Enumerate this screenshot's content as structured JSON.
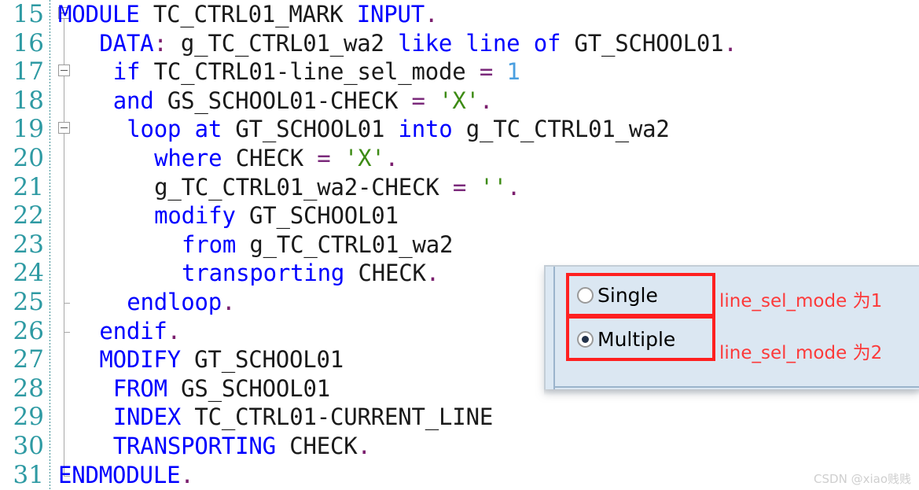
{
  "editor": {
    "first_line_number": 15,
    "colors": {
      "keyword": "#0000ff",
      "identifier": "#1a1a1a",
      "string": "#3d8b14",
      "number": "#4a9fe0",
      "operator": "#7b2a7b",
      "punctuation": "#7b1f6e",
      "line_number": "#2e9aa3",
      "background": "#ffffff"
    },
    "lines": [
      {
        "number": "15",
        "fold": "box",
        "indent": 0,
        "tokens": [
          {
            "t": "MODULE",
            "c": "kw"
          },
          {
            "t": " ",
            "c": "id"
          },
          {
            "t": "TC_CTRL01_MARK",
            "c": "id"
          },
          {
            "t": " ",
            "c": "id"
          },
          {
            "t": "INPUT",
            "c": "kw"
          },
          {
            "t": ".",
            "c": "pun"
          }
        ]
      },
      {
        "number": "16",
        "fold": "line",
        "indent": 3,
        "tokens": [
          {
            "t": "DATA",
            "c": "kw"
          },
          {
            "t": ":",
            "c": "pun"
          },
          {
            "t": " ",
            "c": "id"
          },
          {
            "t": "g_TC_CTRL01_wa2",
            "c": "id"
          },
          {
            "t": " ",
            "c": "id"
          },
          {
            "t": "like",
            "c": "kw"
          },
          {
            "t": " ",
            "c": "id"
          },
          {
            "t": "line",
            "c": "kw"
          },
          {
            "t": " ",
            "c": "id"
          },
          {
            "t": "of",
            "c": "kw"
          },
          {
            "t": " ",
            "c": "id"
          },
          {
            "t": "GT_SCHOOL01",
            "c": "id"
          },
          {
            "t": ".",
            "c": "pun"
          }
        ]
      },
      {
        "number": "17",
        "fold": "box",
        "indent": 4,
        "tokens": [
          {
            "t": "if",
            "c": "kw"
          },
          {
            "t": " ",
            "c": "id"
          },
          {
            "t": "TC_CTRL01-line_sel_mode",
            "c": "id"
          },
          {
            "t": " ",
            "c": "id"
          },
          {
            "t": "=",
            "c": "op"
          },
          {
            "t": " ",
            "c": "id"
          },
          {
            "t": "1",
            "c": "num"
          }
        ]
      },
      {
        "number": "18",
        "fold": "line",
        "indent": 4,
        "tokens": [
          {
            "t": "and",
            "c": "kw"
          },
          {
            "t": " ",
            "c": "id"
          },
          {
            "t": "GS_SCHOOL01-CHECK",
            "c": "id"
          },
          {
            "t": " ",
            "c": "id"
          },
          {
            "t": "=",
            "c": "op"
          },
          {
            "t": " ",
            "c": "id"
          },
          {
            "t": "'X'",
            "c": "str"
          },
          {
            "t": ".",
            "c": "pun"
          }
        ]
      },
      {
        "number": "19",
        "fold": "box",
        "indent": 5,
        "tokens": [
          {
            "t": "loop",
            "c": "kw"
          },
          {
            "t": " ",
            "c": "id"
          },
          {
            "t": "at",
            "c": "kw"
          },
          {
            "t": " ",
            "c": "id"
          },
          {
            "t": "GT_SCHOOL01",
            "c": "id"
          },
          {
            "t": " ",
            "c": "id"
          },
          {
            "t": "into",
            "c": "kw"
          },
          {
            "t": " ",
            "c": "id"
          },
          {
            "t": "g_TC_CTRL01_wa2",
            "c": "id"
          }
        ]
      },
      {
        "number": "20",
        "fold": "line",
        "indent": 7,
        "tokens": [
          {
            "t": "where",
            "c": "kw"
          },
          {
            "t": " ",
            "c": "id"
          },
          {
            "t": "CHECK",
            "c": "id"
          },
          {
            "t": " ",
            "c": "id"
          },
          {
            "t": "=",
            "c": "op"
          },
          {
            "t": " ",
            "c": "id"
          },
          {
            "t": "'X'",
            "c": "str"
          },
          {
            "t": ".",
            "c": "pun"
          }
        ]
      },
      {
        "number": "21",
        "fold": "line",
        "indent": 7,
        "tokens": [
          {
            "t": "g_TC_CTRL01_wa2-CHECK",
            "c": "id"
          },
          {
            "t": " ",
            "c": "id"
          },
          {
            "t": "=",
            "c": "op"
          },
          {
            "t": " ",
            "c": "id"
          },
          {
            "t": "''",
            "c": "str"
          },
          {
            "t": ".",
            "c": "pun"
          }
        ]
      },
      {
        "number": "22",
        "fold": "line",
        "indent": 7,
        "tokens": [
          {
            "t": "modify",
            "c": "kw"
          },
          {
            "t": " ",
            "c": "id"
          },
          {
            "t": "GT_SCHOOL01",
            "c": "id"
          }
        ]
      },
      {
        "number": "23",
        "fold": "line",
        "indent": 9,
        "tokens": [
          {
            "t": "from",
            "c": "kw"
          },
          {
            "t": " ",
            "c": "id"
          },
          {
            "t": "g_TC_CTRL01_wa2",
            "c": "id"
          }
        ]
      },
      {
        "number": "24",
        "fold": "line",
        "indent": 9,
        "tokens": [
          {
            "t": "transporting",
            "c": "kw"
          },
          {
            "t": " ",
            "c": "id"
          },
          {
            "t": "CHECK",
            "c": "id"
          },
          {
            "t": ".",
            "c": "pun"
          }
        ]
      },
      {
        "number": "25",
        "fold": "end",
        "indent": 5,
        "tokens": [
          {
            "t": "endloop",
            "c": "kw"
          },
          {
            "t": ".",
            "c": "pun"
          }
        ]
      },
      {
        "number": "26",
        "fold": "end",
        "indent": 3,
        "tokens": [
          {
            "t": "endif",
            "c": "kw"
          },
          {
            "t": ".",
            "c": "pun"
          }
        ]
      },
      {
        "number": "27",
        "fold": "line",
        "indent": 3,
        "tokens": [
          {
            "t": "MODIFY",
            "c": "kw"
          },
          {
            "t": " ",
            "c": "id"
          },
          {
            "t": "GT_SCHOOL01",
            "c": "id"
          }
        ]
      },
      {
        "number": "28",
        "fold": "line",
        "indent": 4,
        "tokens": [
          {
            "t": "FROM",
            "c": "kw"
          },
          {
            "t": " ",
            "c": "id"
          },
          {
            "t": "GS_SCHOOL01",
            "c": "id"
          }
        ]
      },
      {
        "number": "29",
        "fold": "line",
        "indent": 4,
        "tokens": [
          {
            "t": "INDEX",
            "c": "kw"
          },
          {
            "t": " ",
            "c": "id"
          },
          {
            "t": "TC_CTRL01-CURRENT_LINE",
            "c": "id"
          }
        ]
      },
      {
        "number": "30",
        "fold": "line",
        "indent": 4,
        "tokens": [
          {
            "t": "TRANSPORTING",
            "c": "kw"
          },
          {
            "t": " ",
            "c": "id"
          },
          {
            "t": "CHECK",
            "c": "id"
          },
          {
            "t": ".",
            "c": "pun"
          }
        ]
      },
      {
        "number": "31",
        "fold": "end",
        "indent": 0,
        "tokens": [
          {
            "t": "ENDMODULE",
            "c": "kw"
          },
          {
            "t": ".",
            "c": "pun"
          }
        ]
      }
    ]
  },
  "dialog": {
    "background_color": "#dbe7f2",
    "highlight_color": "#ff2020",
    "options": [
      {
        "label": "Single",
        "selected": false
      },
      {
        "label": "Multiple",
        "selected": true
      }
    ],
    "annotations": [
      "line_sel_mode 为1",
      "line_sel_mode 为2"
    ]
  },
  "watermark": {
    "text": "CSDN @xiao贱贱"
  }
}
